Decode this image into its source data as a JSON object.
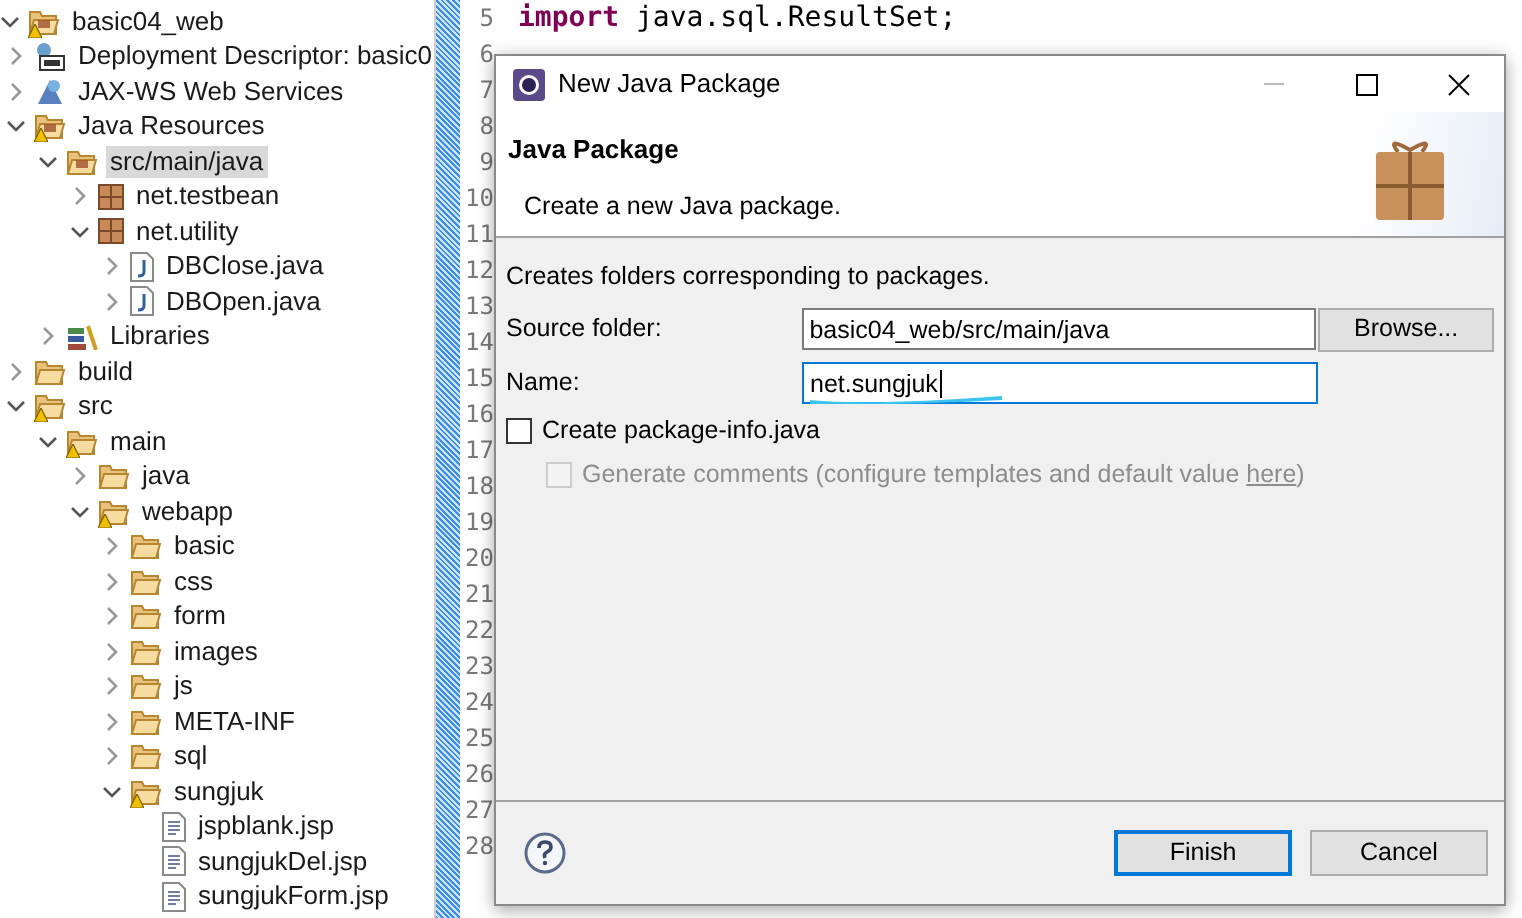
{
  "project_tree": [
    {
      "label": "basic04_web",
      "kind": "project",
      "warning": true,
      "expanded": true,
      "selected": false,
      "children": [
        {
          "label": "Deployment Descriptor: basic0",
          "kind": "descriptor",
          "warning": false,
          "expanded": false,
          "selected": false
        },
        {
          "label": "JAX-WS Web Services",
          "kind": "webservices",
          "warning": false,
          "expanded": false,
          "selected": false
        },
        {
          "label": "Java Resources",
          "kind": "resources",
          "warning": true,
          "expanded": true,
          "selected": false,
          "children": [
            {
              "label": "src/main/java",
              "kind": "source-folder",
              "warning": false,
              "expanded": true,
              "selected": true,
              "children": [
                {
                  "label": "net.testbean",
                  "kind": "package",
                  "warning": false,
                  "expanded": false,
                  "selected": false
                },
                {
                  "label": "net.utility",
                  "kind": "package",
                  "warning": false,
                  "expanded": true,
                  "selected": false,
                  "children": [
                    {
                      "label": "DBClose.java",
                      "kind": "java-file",
                      "warning": false,
                      "expanded": false,
                      "selected": false
                    },
                    {
                      "label": "DBOpen.java",
                      "kind": "java-file",
                      "warning": false,
                      "expanded": false,
                      "selected": false
                    }
                  ]
                }
              ]
            },
            {
              "label": "Libraries",
              "kind": "library",
              "warning": false,
              "expanded": false,
              "selected": false
            }
          ]
        },
        {
          "label": "build",
          "kind": "folder",
          "warning": false,
          "expanded": false,
          "selected": false
        },
        {
          "label": "src",
          "kind": "folder",
          "warning": true,
          "expanded": true,
          "selected": false,
          "children": [
            {
              "label": "main",
              "kind": "folder",
              "warning": true,
              "expanded": true,
              "selected": false,
              "children": [
                {
                  "label": "java",
                  "kind": "folder",
                  "warning": false,
                  "expanded": false,
                  "selected": false
                },
                {
                  "label": "webapp",
                  "kind": "folder",
                  "warning": true,
                  "expanded": true,
                  "selected": false,
                  "children": [
                    {
                      "label": "basic",
                      "kind": "folder",
                      "warning": false,
                      "expanded": false,
                      "selected": false
                    },
                    {
                      "label": "css",
                      "kind": "folder",
                      "warning": false,
                      "expanded": false,
                      "selected": false
                    },
                    {
                      "label": "form",
                      "kind": "folder",
                      "warning": false,
                      "expanded": false,
                      "selected": false
                    },
                    {
                      "label": "images",
                      "kind": "folder",
                      "warning": false,
                      "expanded": false,
                      "selected": false
                    },
                    {
                      "label": "js",
                      "kind": "folder",
                      "warning": false,
                      "expanded": false,
                      "selected": false
                    },
                    {
                      "label": "META-INF",
                      "kind": "folder",
                      "warning": false,
                      "expanded": false,
                      "selected": false
                    },
                    {
                      "label": "sql",
                      "kind": "folder",
                      "warning": false,
                      "expanded": false,
                      "selected": false
                    },
                    {
                      "label": "sungjuk",
                      "kind": "folder",
                      "warning": true,
                      "expanded": true,
                      "selected": false,
                      "children": [
                        {
                          "label": "jspblank.jsp",
                          "kind": "jsp-file",
                          "warning": false,
                          "selected": false
                        },
                        {
                          "label": "sungjukDel.jsp",
                          "kind": "jsp-file",
                          "warning": false,
                          "selected": false
                        },
                        {
                          "label": "sungjukForm.jsp",
                          "kind": "jsp-file",
                          "warning": false,
                          "selected": false
                        }
                      ]
                    }
                  ]
                }
              ]
            }
          ]
        }
      ]
    }
  ],
  "editor": {
    "line_numbers": [
      "5",
      "6",
      "7",
      "8",
      "9",
      "10",
      "11",
      "12",
      "13",
      "14",
      "15",
      "16",
      "17",
      "18",
      "19",
      "20",
      "21",
      "22",
      "23",
      "24",
      "25",
      "26",
      "27",
      "28"
    ],
    "code_line": {
      "keyword": "import",
      "rest": " java.sql.ResultSet;"
    }
  },
  "dialog": {
    "title": "New Java Package",
    "header_title": "Java Package",
    "header_description": "Create a new Java package.",
    "intro": "Creates folders corresponding to packages.",
    "source_folder": {
      "label": "Source folder:",
      "value": "basic04_web/src/main/java",
      "button": "Browse..."
    },
    "name": {
      "label": "Name:",
      "value": "net.sungjuk",
      "focused": true
    },
    "create_package_info": {
      "label": "Create package-info.java",
      "checked": false,
      "disabled": false
    },
    "generate_comments": {
      "label": "Generate comments (configure templates and default value ",
      "link": "here",
      "after": ")",
      "checked": false,
      "disabled": true
    },
    "buttons": [
      {
        "label": "Finish",
        "default": true
      },
      {
        "label": "Cancel",
        "default": false
      }
    ]
  }
}
